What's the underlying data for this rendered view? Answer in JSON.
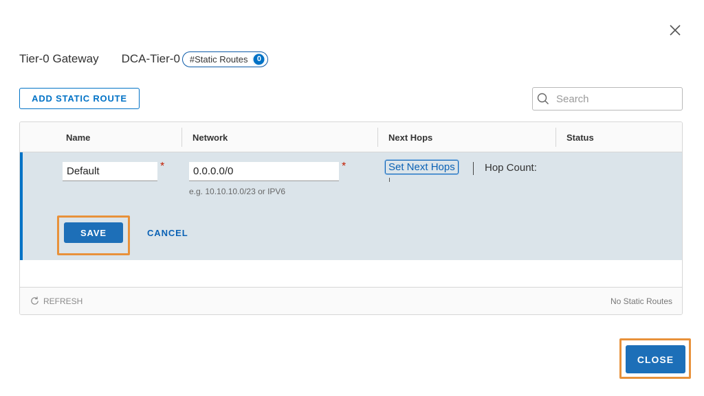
{
  "header": {
    "gateway_type": "Tier-0 Gateway",
    "gateway_name": "DCA-Tier-0",
    "chip_label": "#Static Routes",
    "chip_count": "0"
  },
  "toolbar": {
    "add_label": "ADD STATIC ROUTE",
    "search_placeholder": "Search"
  },
  "grid": {
    "columns": [
      "Name",
      "Network",
      "Next Hops",
      "Status"
    ],
    "edit_row": {
      "name_value": "Default",
      "network_value": "0.0.0.0/0",
      "network_hint": "e.g. 10.10.10.0/23 or IPV6",
      "next_hops_link": "Set Next Hops",
      "hop_count_label": "Hop Count:",
      "save_label": "SAVE",
      "cancel_label": "CANCEL"
    },
    "footer": {
      "refresh_label": "REFRESH",
      "status_text": "No Static Routes"
    }
  },
  "dialog": {
    "close_label": "CLOSE"
  },
  "colors": {
    "accent": "#0072c6",
    "highlight": "#e8913a",
    "edit_row_bg": "#dbe4ea",
    "required": "#c21d00"
  },
  "icons": [
    "close-icon",
    "search-icon",
    "refresh-icon"
  ]
}
